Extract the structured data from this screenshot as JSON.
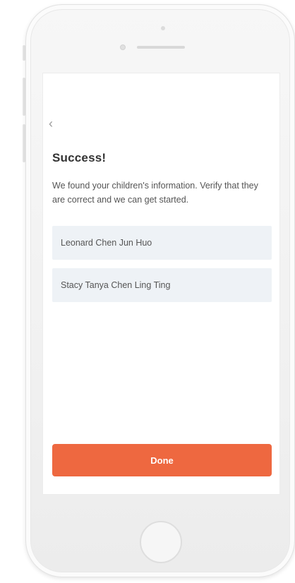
{
  "screen": {
    "back_symbol": "‹",
    "title": "Success!",
    "subtitle": "We found your children's information. Verify that they are correct and we can get started.",
    "children": [
      {
        "name": "Leonard Chen Jun Huo"
      },
      {
        "name": "Stacy Tanya Chen Ling Ting"
      }
    ],
    "done_label": "Done"
  },
  "colors": {
    "accent": "#ee6840",
    "row_background": "#eef2f6",
    "title_text": "#333333",
    "body_text": "#555555"
  },
  "icons": {
    "back": "chevron-left-icon",
    "home": "home-button-icon"
  }
}
